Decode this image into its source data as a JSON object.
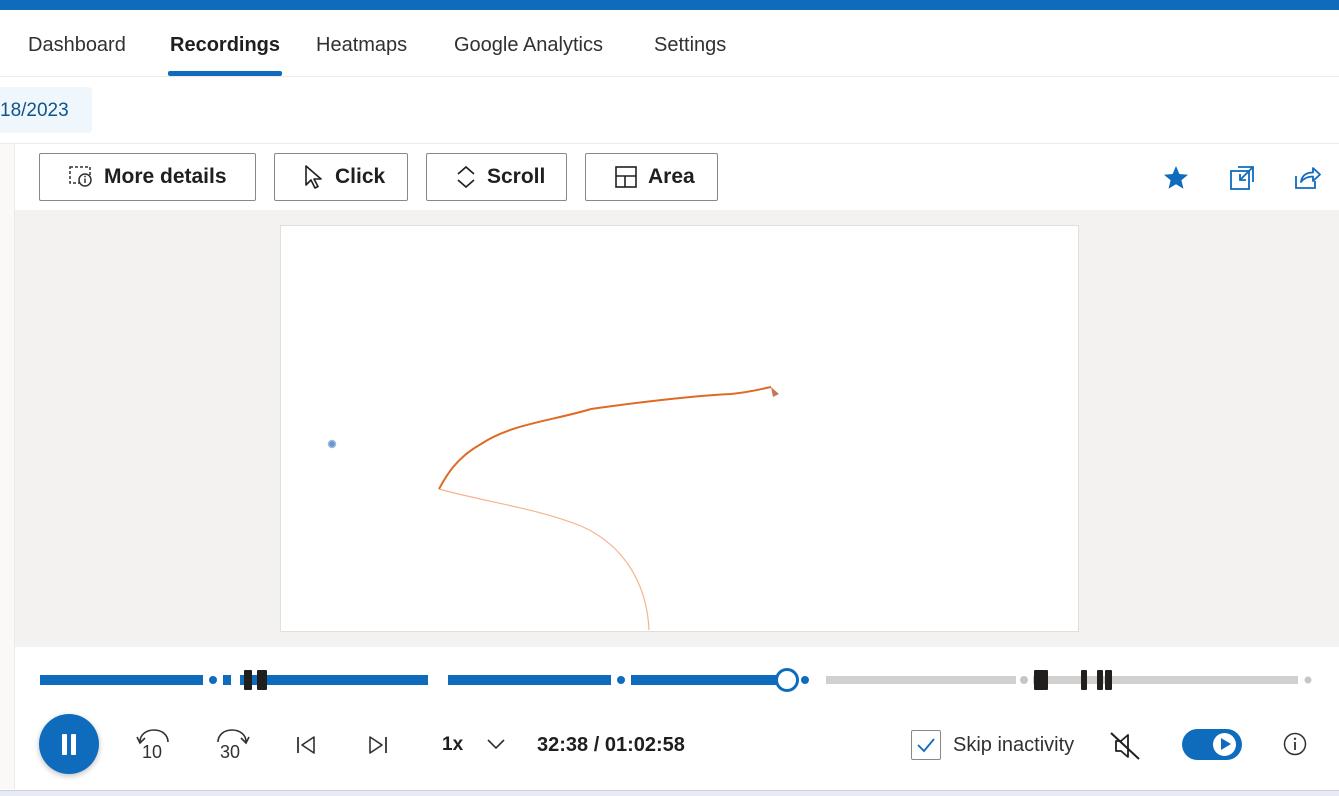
{
  "nav": {
    "tabs": [
      {
        "label": "Dashboard",
        "active": false
      },
      {
        "label": "Recordings",
        "active": true
      },
      {
        "label": "Heatmaps",
        "active": false
      },
      {
        "label": "Google Analytics",
        "active": false
      },
      {
        "label": "Settings",
        "active": false
      }
    ]
  },
  "filter": {
    "date_fragment": "18/2023"
  },
  "toolbar": {
    "more_details": "More details",
    "click": "Click",
    "scroll": "Scroll",
    "area": "Area"
  },
  "actions": {
    "favorite_icon": "star-icon",
    "open_icon": "open-in-new-window-icon",
    "share_icon": "share-icon"
  },
  "player": {
    "skip_back_seconds": "10",
    "skip_forward_seconds": "30",
    "speed": "1x",
    "time_display": "32:38 / 01:02:58",
    "current_time": "32:38",
    "duration": "01:02:58",
    "progress_fraction": 0.52,
    "skip_inactivity_label": "Skip inactivity",
    "skip_inactivity_checked": true,
    "muted": true,
    "autoplay_on": true
  },
  "colors": {
    "accent": "#0f6cbd",
    "track_unplayed": "#d2d0ce",
    "mouse_trail": "#e06a25"
  }
}
